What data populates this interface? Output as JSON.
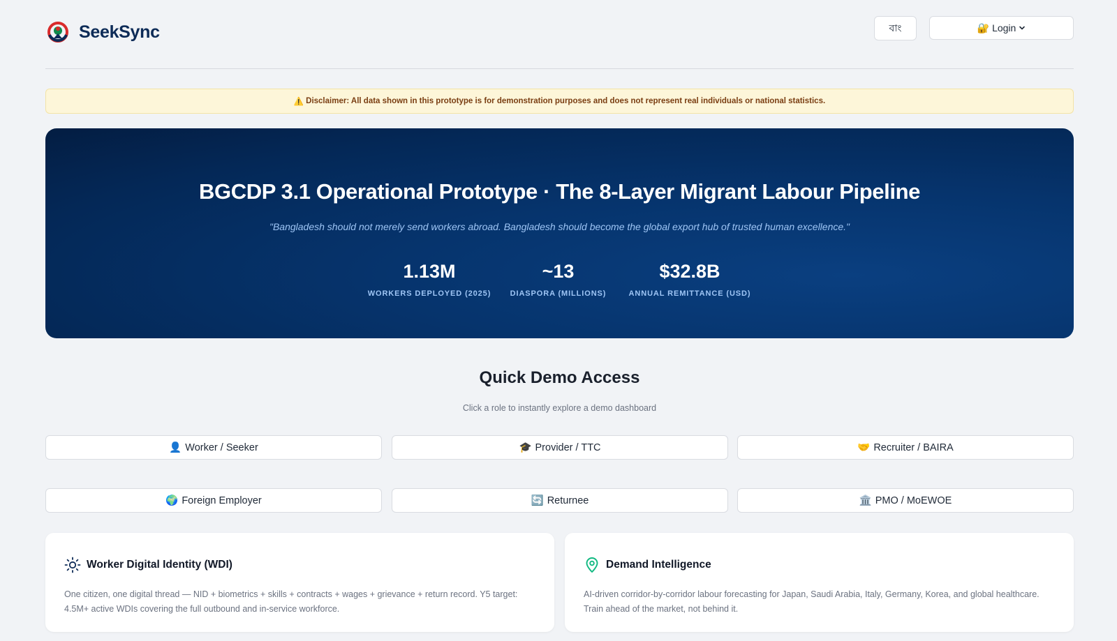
{
  "brand": {
    "name": "SeekSync",
    "logo_icon": "globe-logo-icon"
  },
  "header": {
    "lang_label": "বাং",
    "login_icon": "🔐",
    "login_label": "Login"
  },
  "disclaimer": {
    "icon": "⚠️",
    "text": "Disclaimer: All data shown in this prototype is for demonstration purposes and does not represent real individuals or national statistics."
  },
  "hero": {
    "title": "BGCDP 3.1 Operational Prototype · The 8-Layer Migrant Labour Pipeline",
    "quote": "\"Bangladesh should not merely send workers abroad. Bangladesh should become the global export hub of trusted human excellence.\"",
    "stats": [
      {
        "value": "1.13M",
        "label": "WORKERS DEPLOYED (2025)"
      },
      {
        "value": "~13",
        "label": "DIASPORA (MILLIONS)"
      },
      {
        "value": "$32.8B",
        "label": "ANNUAL REMITTANCE (USD)"
      }
    ]
  },
  "quick_demo": {
    "title": "Quick Demo Access",
    "subtitle": "Click a role to instantly explore a demo dashboard",
    "roles": [
      {
        "icon": "👤",
        "label": "Worker / Seeker"
      },
      {
        "icon": "🎓",
        "label": "Provider / TTC"
      },
      {
        "icon": "🤝",
        "label": "Recruiter / BAIRA"
      },
      {
        "icon": "🌍",
        "label": "Foreign Employer"
      },
      {
        "icon": "🔄",
        "label": "Returnee"
      },
      {
        "icon": "🏛️",
        "label": "PMO / MoEWOE"
      }
    ]
  },
  "features": [
    {
      "icon": "sun-icon",
      "title": "Worker Digital Identity (WDI)",
      "body": "One citizen, one digital thread — NID + biometrics + skills + contracts + wages + grievance + return record. Y5 target: 4.5M+ active WDIs covering the full outbound and in-service workforce."
    },
    {
      "icon": "location-pin-icon",
      "title": "Demand Intelligence",
      "body": "AI-driven corridor-by-corridor labour forecasting for Japan, Saudi Arabia, Italy, Germany, Korea, and global healthcare. Train ahead of the market, not behind it."
    }
  ],
  "colors": {
    "brand_navy": "#0d2b57",
    "hero_bg": "#042857",
    "hero_accent": "#9ec5f5",
    "disclaimer_bg": "#fdf6d9",
    "disclaimer_text": "#7a3e12",
    "pin_green": "#10b981"
  }
}
